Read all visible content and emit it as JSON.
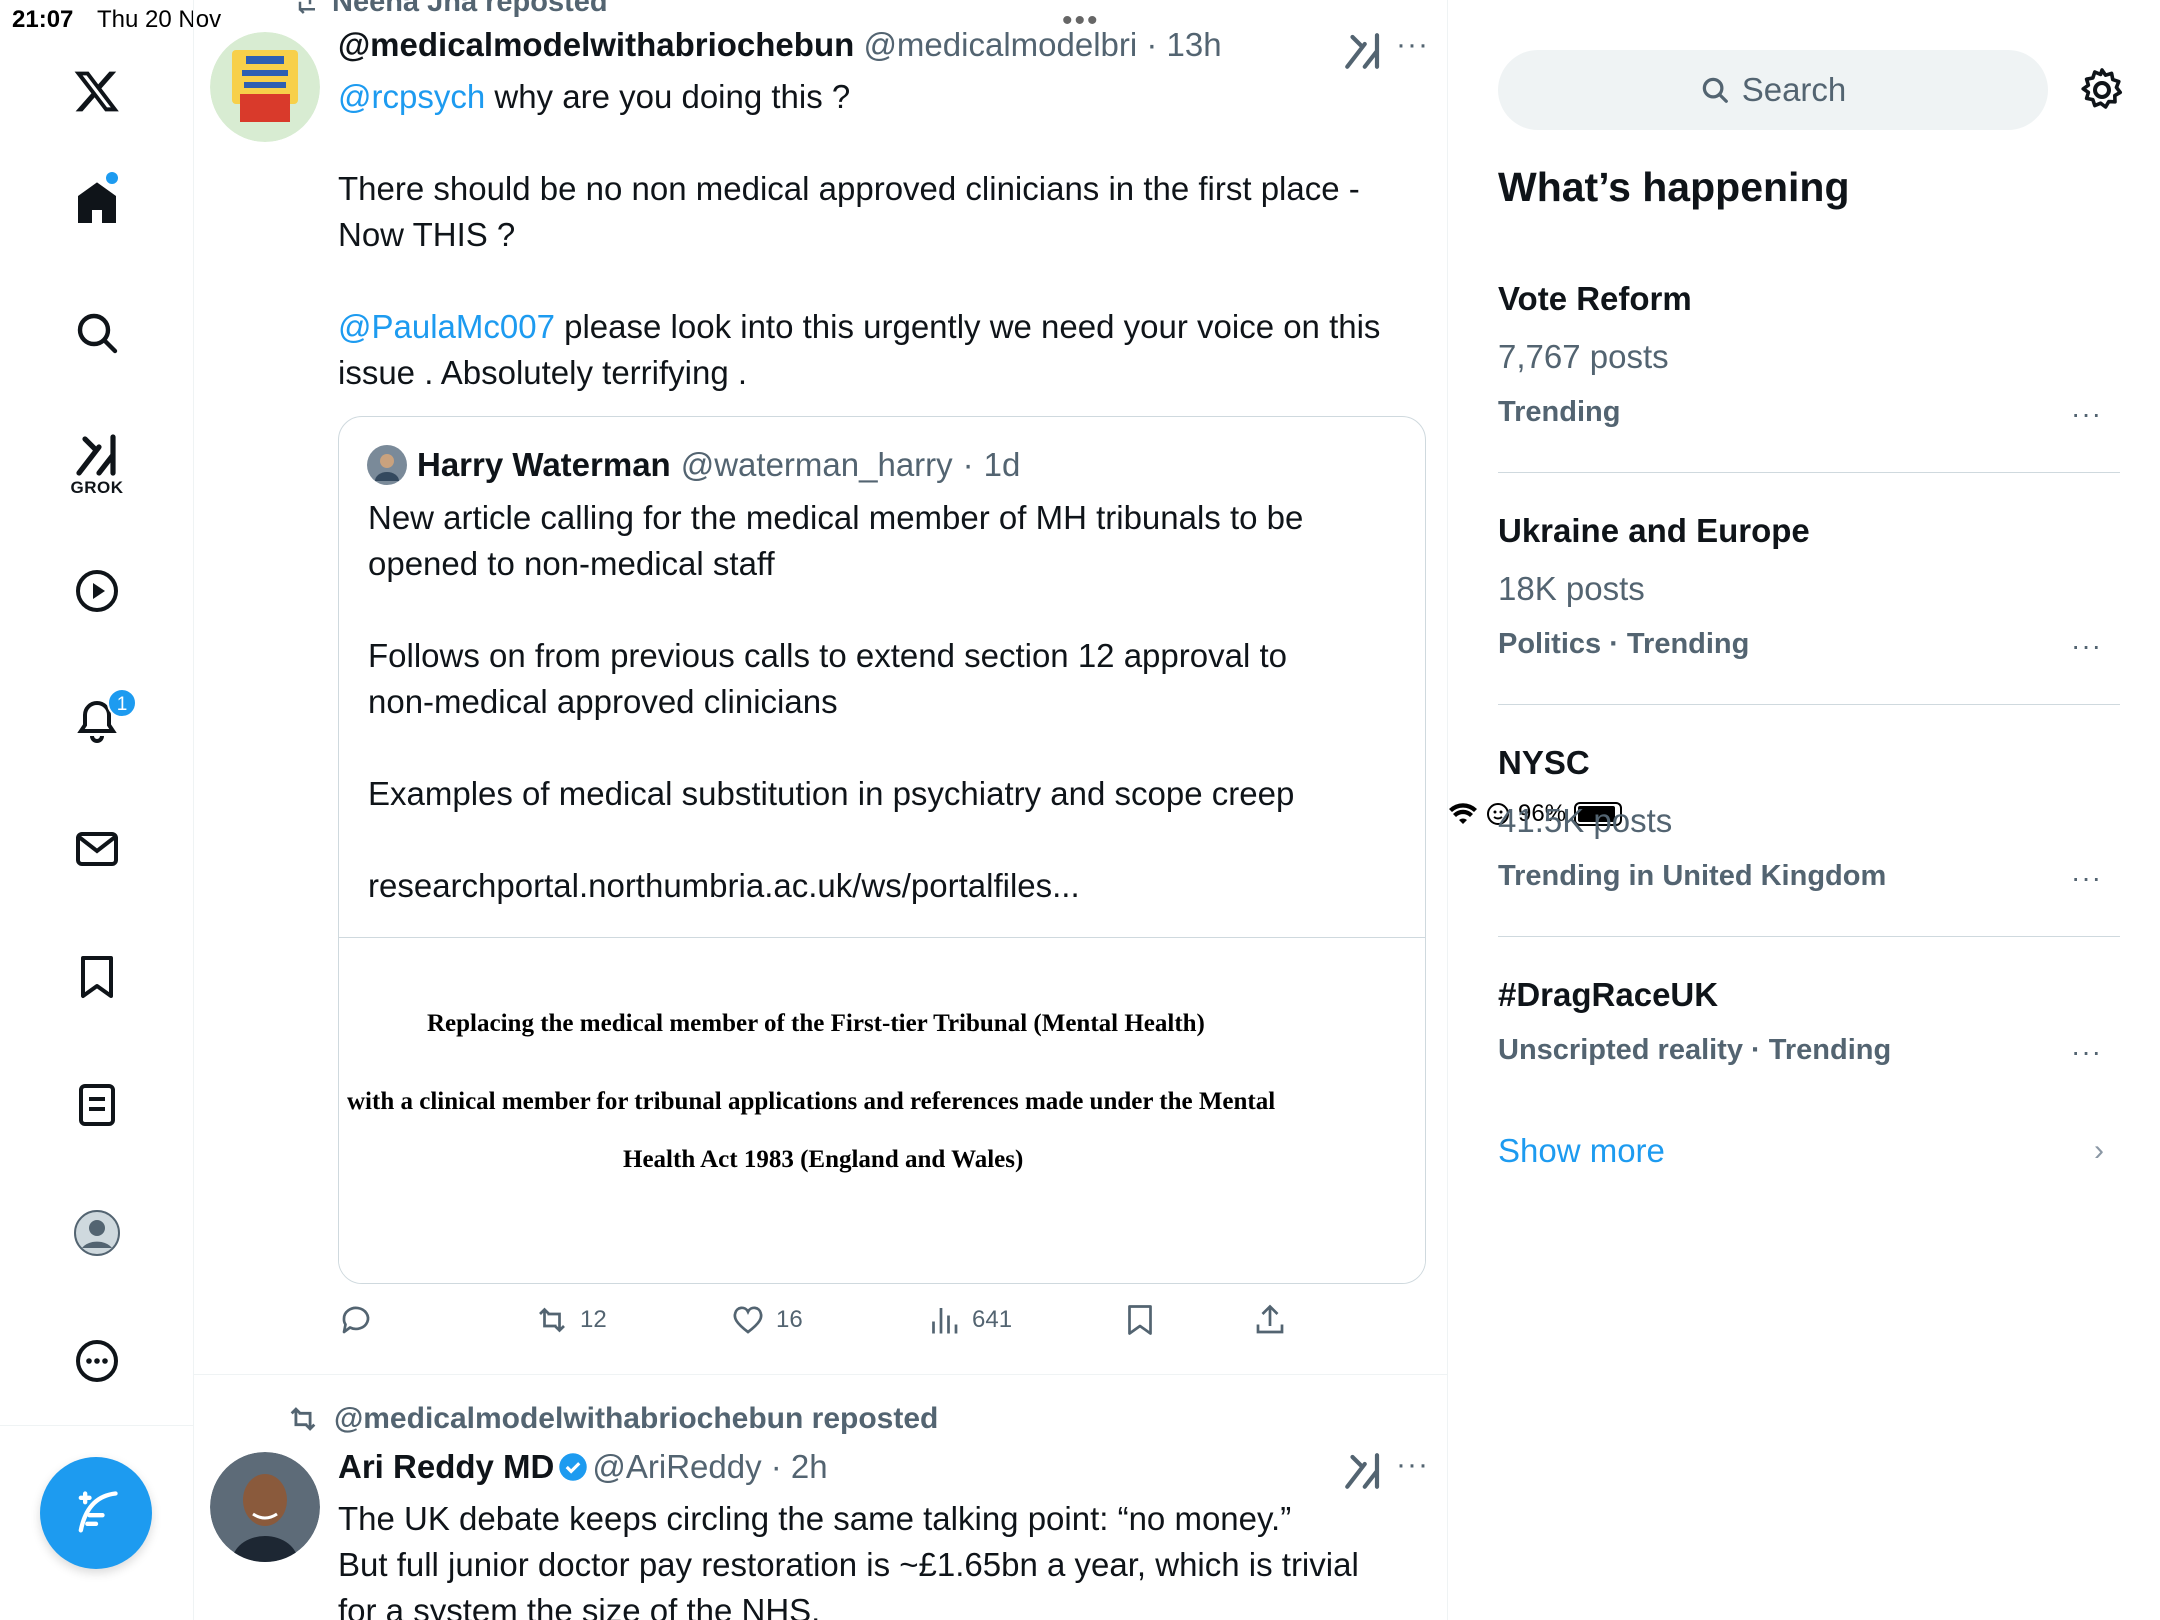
{
  "status_bar": {
    "time": "21:07",
    "date": "Thu 20 Nov",
    "battery": "96%"
  },
  "nav": {
    "grok_label": "GROK",
    "notification_count": "1"
  },
  "top_post": {
    "repost_label": "Neena Jha reposted",
    "name": "@medicalmodelwithabriochebun",
    "handle": "@medicalmodelbri",
    "time": "13h",
    "text_mention1": "@rcpsych",
    "text_line1": " why are you doing this ?",
    "text_line2": "There should be no non medical approved clinicians in the first place -",
    "text_line3": "Now THIS ?",
    "text_mention2": "@PaulaMc007",
    "text_line4": " please look into this urgently we need your voice on this",
    "text_line5": "issue . Absolutely terrifying .",
    "quote": {
      "name": "Harry Waterman",
      "handle": "@waterman_harry",
      "time": "1d",
      "line1": "New article calling for the medical member of MH tribunals to be",
      "line2": "opened to non-medical staff",
      "line3": "Follows on from previous calls to extend section 12 approval to",
      "line4": "non-medical approved clinicians",
      "line5": "Examples of medical substitution in psychiatry and scope creep",
      "line6": "researchportal.northumbria.ac.uk/ws/portalfiles...",
      "doc_line1": "Replacing the medical member of the First-tier Tribunal (Mental Health)",
      "doc_line2": "with a clinical member for tribunal applications and references made under the Mental",
      "doc_line3": "Health Act 1983 (England and Wales)"
    },
    "actions": {
      "reposts": "12",
      "likes": "16",
      "views": "641"
    }
  },
  "second_post": {
    "repost_label": "@medicalmodelwithabriochebun reposted",
    "name": "Ari Reddy MD",
    "handle": "@AriReddy",
    "time": "2h",
    "line1": "The UK debate keeps circling the same talking point: “no money.”",
    "line2": "But full junior doctor pay restoration is ~£1.65bn a year, which is trivial",
    "line3": "for a system the size of the NHS."
  },
  "sidebar": {
    "search_placeholder": "Search",
    "section_title": "What’s happening",
    "trends": [
      {
        "name": "Vote Reform",
        "posts": "7,767 posts",
        "meta": "Trending"
      },
      {
        "name": "Ukraine and Europe",
        "posts": "18K posts",
        "meta": "Politics · Trending"
      },
      {
        "name": "NYSC",
        "posts": "41.5K posts",
        "meta": "Trending in United Kingdom"
      },
      {
        "name": "#DragRaceUK",
        "posts": "",
        "meta": "Unscripted reality · Trending"
      }
    ],
    "show_more": "Show more"
  },
  "colors": {
    "accent": "#1d9bf0",
    "secondary_text": "#536471",
    "border": "#cfd9de"
  }
}
